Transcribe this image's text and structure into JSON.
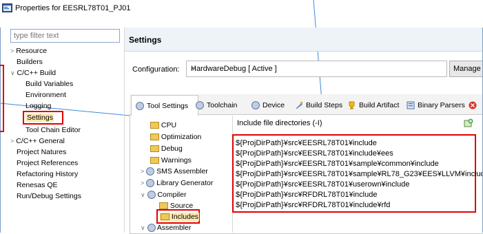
{
  "window": {
    "title": "Properties for EESRL78T01_PJ01"
  },
  "filter": {
    "placeholder": "type filter text"
  },
  "nav_tree": [
    {
      "label": "Resource",
      "expander": ">"
    },
    {
      "label": "Builders"
    },
    {
      "label": "C/C++ Build",
      "expander": "∨"
    },
    {
      "label": "Build Variables"
    },
    {
      "label": "Environment"
    },
    {
      "label": "Logging"
    },
    {
      "label": "Settings"
    },
    {
      "label": "Tool Chain Editor"
    },
    {
      "label": "C/C++ General",
      "expander": ">"
    },
    {
      "label": "Project Natures"
    },
    {
      "label": "Project References"
    },
    {
      "label": "Refactoring History"
    },
    {
      "label": "Renesas QE"
    },
    {
      "label": "Run/Debug Settings"
    }
  ],
  "page_header": "Settings",
  "configuration": {
    "label": "Configuration:",
    "value": "HardwareDebug  [ Active ]",
    "manage": "Manage"
  },
  "tabs": [
    {
      "label": "Tool Settings"
    },
    {
      "label": "Toolchain"
    },
    {
      "label": "Device"
    },
    {
      "label": "Build Steps"
    },
    {
      "label": "Build Artifact"
    },
    {
      "label": "Binary Parsers"
    }
  ],
  "tool_tree": [
    {
      "label": "CPU"
    },
    {
      "label": "Optimization"
    },
    {
      "label": "Debug"
    },
    {
      "label": "Warnings"
    },
    {
      "label": "SMS Assembler",
      "expander": ">"
    },
    {
      "label": "Library Generator",
      "expander": ">"
    },
    {
      "label": "Compiler",
      "expander": "∨"
    },
    {
      "label": "Source"
    },
    {
      "label": "Includes"
    },
    {
      "label": "Assembler",
      "expander": "∨"
    }
  ],
  "includes": {
    "header": "Include file directories (-I)",
    "rows": [
      "${ProjDirPath}¥src¥EESRL78T01¥include",
      "${ProjDirPath}¥src¥EESRL78T01¥include¥ees",
      "${ProjDirPath}¥src¥EESRL78T01¥sample¥common¥include",
      "${ProjDirPath}¥src¥EESRL78T01¥sample¥RL78_G23¥EES¥LLVM¥include",
      "${ProjDirPath}¥src¥EESRL78T01¥userown¥include",
      "${ProjDirPath}¥src¥RFDRL78T01¥include",
      "${ProjDirPath}¥src¥RFDRL78T01¥include¥rfd"
    ]
  }
}
